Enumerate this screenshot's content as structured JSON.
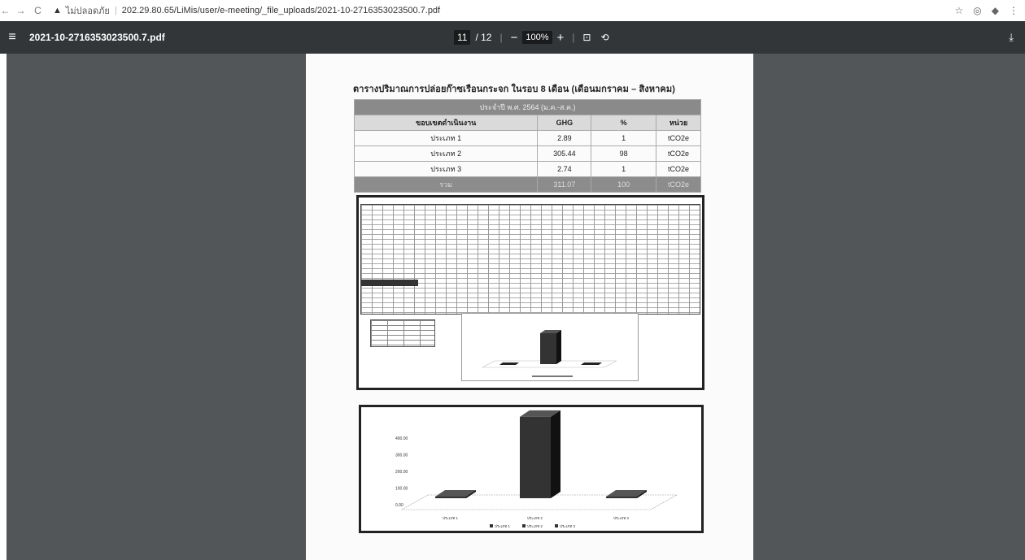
{
  "browser": {
    "security_label": "ไม่ปลอดภัย",
    "url": "202.29.80.65/LiMis/user/e-meeting/_file_uploads/2021-10-2716353023500.7.pdf"
  },
  "pdf_toolbar": {
    "filename": "2021-10-2716353023500.7.pdf",
    "page_current": "11",
    "page_total": "/ 12",
    "zoom": "100%"
  },
  "document": {
    "title": "ตารางปริมาณการปล่อยก๊าซเรือนกระจก ในรอบ 8 เดือน (เดือนมกราคม – สิงหาคม)",
    "table": {
      "caption": "ประจำปี พ.ศ. 2564 (ม.ค.-ส.ค.)",
      "headers": [
        "ขอบเขตดำเนินงาน",
        "GHG",
        "%",
        "หน่วย"
      ],
      "rows": [
        [
          "ประเภท 1",
          "2.89",
          "1",
          "tCO2e"
        ],
        [
          "ประเภท 2",
          "305.44",
          "98",
          "tCO2e"
        ],
        [
          "ประเภท 3",
          "2.74",
          "1",
          "tCO2e"
        ]
      ],
      "total": [
        "รวม",
        "311.07",
        "100",
        "tCO2e"
      ]
    }
  },
  "chart_data": {
    "type": "bar",
    "categories": [
      "ประเภท 1",
      "ประเภท 2",
      "ประเภท 3"
    ],
    "values": [
      2.89,
      305.44,
      2.74
    ],
    "ylim": [
      0,
      400
    ],
    "yticks": [
      "0.00",
      "100.00",
      "200.00",
      "300.00",
      "400.00"
    ],
    "legend": [
      "ประเภท 1",
      "ประเภท 2",
      "ประเภท 3"
    ],
    "legend_position": "bottom",
    "bar_color": "#333333"
  }
}
